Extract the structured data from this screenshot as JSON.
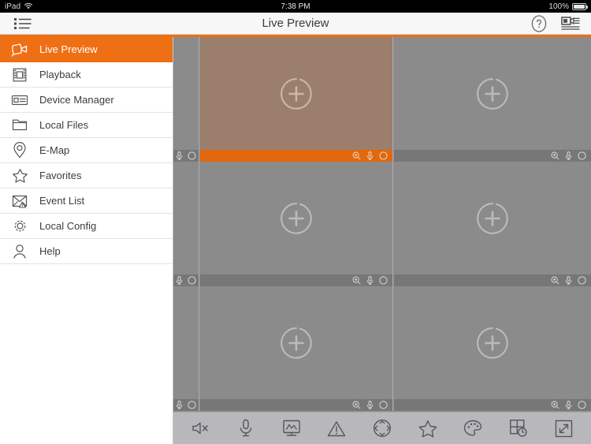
{
  "statusbar": {
    "device": "iPad",
    "wifi_icon": "wifi-icon",
    "time": "7:38 PM",
    "battery_percent": "100%",
    "battery_icon": "battery-full-icon"
  },
  "navbar": {
    "menu_icon": "bulleted-list-icon",
    "title": "Live Preview",
    "help_icon": "question-circle-icon",
    "device_list_icon": "device-stream-icon"
  },
  "colors": {
    "accent": "#ef6f14",
    "accent_rule": "#ee6f12",
    "sidebar_bg": "#ffffff",
    "grid_bg": "#8f8f8f",
    "cell_bg": "#8b8b8b",
    "cell_footer": "#777777",
    "cell_footer_selected": "#e2670d",
    "cell_selected_tint": "#9b7e6c",
    "toolbar_bg": "#b7b7bc",
    "text": "#3c3c3c"
  },
  "sidebar": {
    "items": [
      {
        "label": "Live Preview",
        "icon": "camcorder-icon",
        "active": true
      },
      {
        "label": "Playback",
        "icon": "film-strip-icon",
        "active": false
      },
      {
        "label": "Device Manager",
        "icon": "device-box-icon",
        "active": false
      },
      {
        "label": "Local Files",
        "icon": "folder-icon",
        "active": false
      },
      {
        "label": "E-Map",
        "icon": "map-pin-icon",
        "active": false
      },
      {
        "label": "Favorites",
        "icon": "star-icon",
        "active": false
      },
      {
        "label": "Event List",
        "icon": "envelope-alert-icon",
        "active": false
      },
      {
        "label": "Local Config",
        "icon": "gear-icon",
        "active": false
      },
      {
        "label": "Help",
        "icon": "person-icon",
        "active": false
      }
    ]
  },
  "grid": {
    "layout": "3x3",
    "rows": 3,
    "cols": 2,
    "cell_icons": {
      "add_channel": "plus-circle-icon",
      "zoom": "zoom-in-icon",
      "audio": "microphone-icon",
      "record": "record-circle-icon"
    },
    "cells": [
      {
        "id": "cell-0",
        "selected": false,
        "partial": true,
        "empty": true
      },
      {
        "id": "cell-1",
        "selected": true,
        "partial": false,
        "empty": true
      },
      {
        "id": "cell-2",
        "selected": false,
        "partial": false,
        "empty": true
      },
      {
        "id": "cell-3",
        "selected": false,
        "partial": true,
        "empty": true
      },
      {
        "id": "cell-4",
        "selected": false,
        "partial": false,
        "empty": true
      },
      {
        "id": "cell-5",
        "selected": false,
        "partial": false,
        "empty": true
      },
      {
        "id": "cell-6",
        "selected": false,
        "partial": true,
        "empty": true
      },
      {
        "id": "cell-7",
        "selected": false,
        "partial": false,
        "empty": true
      },
      {
        "id": "cell-8",
        "selected": false,
        "partial": false,
        "empty": true
      }
    ]
  },
  "toolbar": {
    "buttons": [
      {
        "name": "audio-mute-button",
        "icon": "speaker-mute-icon"
      },
      {
        "name": "talk-button",
        "icon": "microphone-icon"
      },
      {
        "name": "snapshot-button",
        "icon": "monitor-wave-icon"
      },
      {
        "name": "alarm-button",
        "icon": "warning-triangle-icon"
      },
      {
        "name": "ptz-button",
        "icon": "ptz-circle-icon"
      },
      {
        "name": "favorites-button",
        "icon": "star-icon"
      },
      {
        "name": "image-color-button",
        "icon": "palette-icon"
      },
      {
        "name": "layout-button",
        "icon": "grid-clock-icon"
      },
      {
        "name": "fullscreen-button",
        "icon": "expand-arrows-icon"
      }
    ]
  }
}
